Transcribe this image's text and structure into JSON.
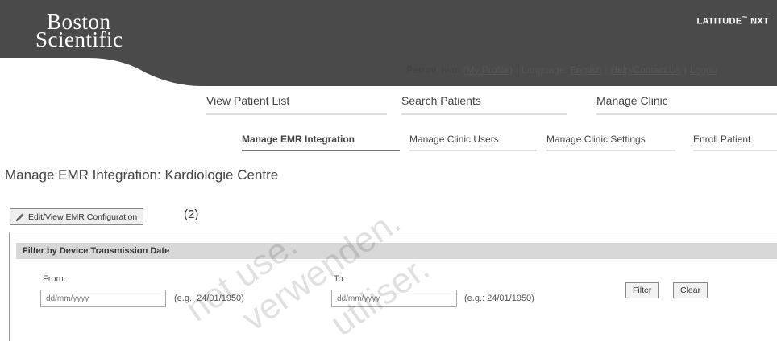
{
  "header": {
    "logo_line1": "Boston",
    "logo_line2": "Scientific",
    "product_name": "LATITUDE",
    "product_tm": "™",
    "product_suffix": " NXT"
  },
  "userbar": {
    "user_name": "Petrov, Ivan",
    "profile_link": "My Profile",
    "language_label": "Language:",
    "language_link": "English",
    "help_link": "Help/Contact Us",
    "logout_link": "Logou"
  },
  "main_nav": {
    "items": [
      {
        "label": "View Patient List"
      },
      {
        "label": "Search Patients"
      },
      {
        "label": "Manage Clinic"
      }
    ]
  },
  "sub_nav": {
    "items": [
      {
        "label": "Manage EMR Integration"
      },
      {
        "label": "Manage Clinic Users"
      },
      {
        "label": "Manage Clinic Settings"
      },
      {
        "label": "Enroll Patient"
      }
    ]
  },
  "page": {
    "title": "Manage EMR Integration: Kardiologie Centre",
    "edit_button": "Edit/View EMR Configuration",
    "annotation": "(2)"
  },
  "filter": {
    "header": "Filter by Device Transmission Date",
    "from_label": "From:",
    "from_placeholder": "dd/mm/yyyy",
    "from_hint": "(e.g.: 24/01/1950)",
    "to_label": "To:",
    "to_placeholder": "dd/mm/yyyy",
    "to_hint": "(e.g.: 24/01/1950)",
    "filter_button": "Filter",
    "clear_button": "Clear"
  },
  "watermark": {
    "line1": "not use.",
    "line2": "verwenden.",
    "line3": "utiliser."
  },
  "colors": {
    "header_bg": "#4a4a4a",
    "filter_header_bg": "#d8d8d8"
  }
}
